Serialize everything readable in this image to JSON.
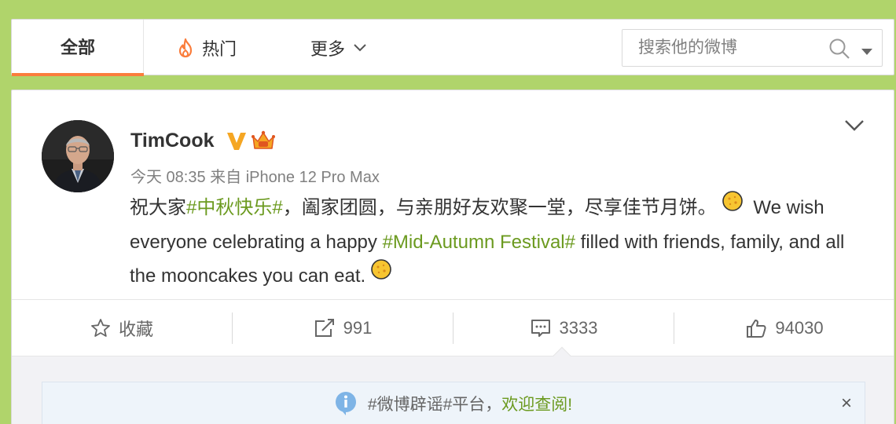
{
  "tabs": {
    "all_label": "全部",
    "hot_label": "热门",
    "more_label": "更多"
  },
  "search": {
    "placeholder": "搜索他的微博"
  },
  "post": {
    "username": "TimCook",
    "time": "今天 08:35",
    "source_prefix": "来自",
    "source": "iPhone 12 Pro Max",
    "text_part1": "祝大家",
    "hashtag1": "#中秋快乐#",
    "text_part2": "，阖家团圆，与亲朋好友欢聚一堂，尽享佳节月饼。",
    "text_part3": " We wish everyone celebrating a happy ",
    "hashtag2": "#Mid-Autumn Festival#",
    "text_part4": " filled with friends, family, and all the mooncakes you can eat."
  },
  "actions": {
    "favorite_label": "收藏",
    "repost_count": "991",
    "comment_count": "3333",
    "like_count": "94030"
  },
  "notice": {
    "prefix": "#微博辟谣#平台，",
    "link_label": "欢迎查阅!",
    "close_label": "×"
  },
  "colors": {
    "background": "#b0d46b",
    "accent_tab": "#fa7d3c",
    "hashtag": "#6b9a1f",
    "verified": "#f5a623"
  },
  "icons": {
    "hot": "fire-icon",
    "more": "chevron-down-icon",
    "search": "search-icon",
    "verified": "verified-v-icon",
    "vip": "crown-vip-icon",
    "options": "chevron-down-icon",
    "favorite": "star-icon",
    "repost": "share-icon",
    "comment": "comment-icon",
    "like": "thumbs-up-icon",
    "notice": "info-icon"
  }
}
